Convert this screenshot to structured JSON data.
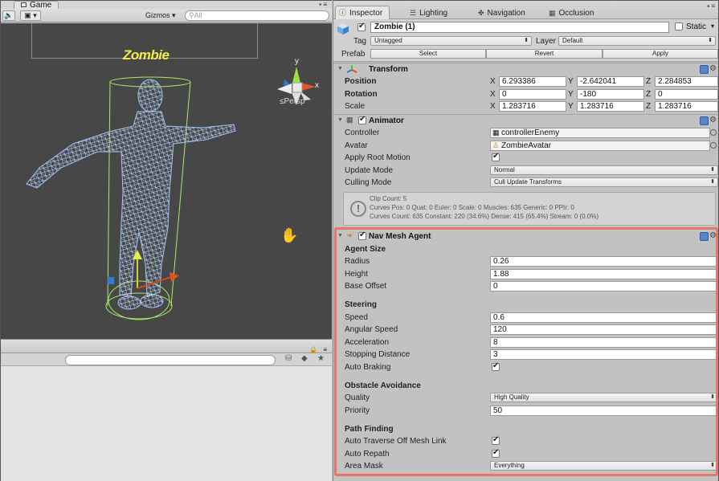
{
  "game_view": {
    "tab_label": "Game",
    "toolbar": {
      "gizmos_label": "Gizmos",
      "search_placeholder": "All"
    },
    "viewport": {
      "object_label": "Zombie",
      "projection_label": "Persp",
      "gizmo_axis_label": "y"
    }
  },
  "inspector": {
    "tabs": [
      {
        "label": "Inspector",
        "icon": "info-icon",
        "active": true
      },
      {
        "label": "Lighting",
        "icon": "lighting-icon"
      },
      {
        "label": "Navigation",
        "icon": "navigation-icon"
      },
      {
        "label": "Occlusion",
        "icon": "occlusion-icon"
      }
    ],
    "object": {
      "enabled": true,
      "name": "Zombie (1)",
      "static_label": "Static",
      "tag_label": "Tag",
      "tag_value": "Untagged",
      "layer_label": "Layer",
      "layer_value": "Default",
      "prefab_label": "Prefab",
      "prefab_buttons": [
        "Select",
        "Revert",
        "Apply"
      ]
    },
    "transform": {
      "title": "Transform",
      "rows": [
        {
          "label": "Position",
          "bold": true,
          "x": "6.293386",
          "y": "-2.642041",
          "z": "2.284853"
        },
        {
          "label": "Rotation",
          "bold": true,
          "x": "0",
          "y": "-180",
          "z": "0"
        },
        {
          "label": "Scale",
          "bold": false,
          "x": "1.283716",
          "y": "1.283716",
          "z": "1.283716"
        }
      ],
      "axis_labels": [
        "X",
        "Y",
        "Z"
      ]
    },
    "animator": {
      "title": "Animator",
      "enabled": true,
      "controller_label": "Controller",
      "controller_value": "controllerEnemy",
      "avatar_label": "Avatar",
      "avatar_value": "ZombieAvatar",
      "apply_root_motion_label": "Apply Root Motion",
      "apply_root_motion": true,
      "update_mode_label": "Update Mode",
      "update_mode_value": "Normal",
      "culling_mode_label": "Culling Mode",
      "culling_mode_value": "Cull Update Transforms",
      "info_lines": [
        "Clip Count: 5",
        "Curves Pos: 0 Quat: 0 Euler: 0 Scale: 0 Muscles: 635 Generic: 0 PPtr: 0",
        "Curves Count: 635 Constant: 220 (34.6%) Dense: 415 (65.4%) Stream: 0 (0.0%)"
      ]
    },
    "nav_mesh_agent": {
      "title": "Nav Mesh Agent",
      "enabled": true,
      "agent_size": {
        "title": "Agent Size",
        "radius_label": "Radius",
        "radius": "0.26",
        "height_label": "Height",
        "height": "1.88",
        "base_offset_label": "Base Offset",
        "base_offset": "0"
      },
      "steering": {
        "title": "Steering",
        "speed_label": "Speed",
        "speed": "0.6",
        "angular_speed_label": "Angular Speed",
        "angular_speed": "120",
        "acceleration_label": "Acceleration",
        "acceleration": "8",
        "stopping_distance_label": "Stopping Distance",
        "stopping_distance": "3",
        "auto_braking_label": "Auto Braking",
        "auto_braking": true
      },
      "obstacle_avoidance": {
        "title": "Obstacle Avoidance",
        "quality_label": "Quality",
        "quality": "High Quality",
        "priority_label": "Priority",
        "priority": "50"
      },
      "path_finding": {
        "title": "Path Finding",
        "auto_traverse_label": "Auto Traverse Off Mesh Link",
        "auto_traverse": true,
        "auto_repath_label": "Auto Repath",
        "auto_repath": true,
        "area_mask_label": "Area Mask",
        "area_mask": "Everything"
      }
    }
  },
  "colors": {
    "highlight_border": "#e8756a",
    "viewport_bg": "#474747",
    "zombie_label": "#f3ea4a",
    "wireframe": "#9fc3f5",
    "collider": "#a8e86a"
  }
}
